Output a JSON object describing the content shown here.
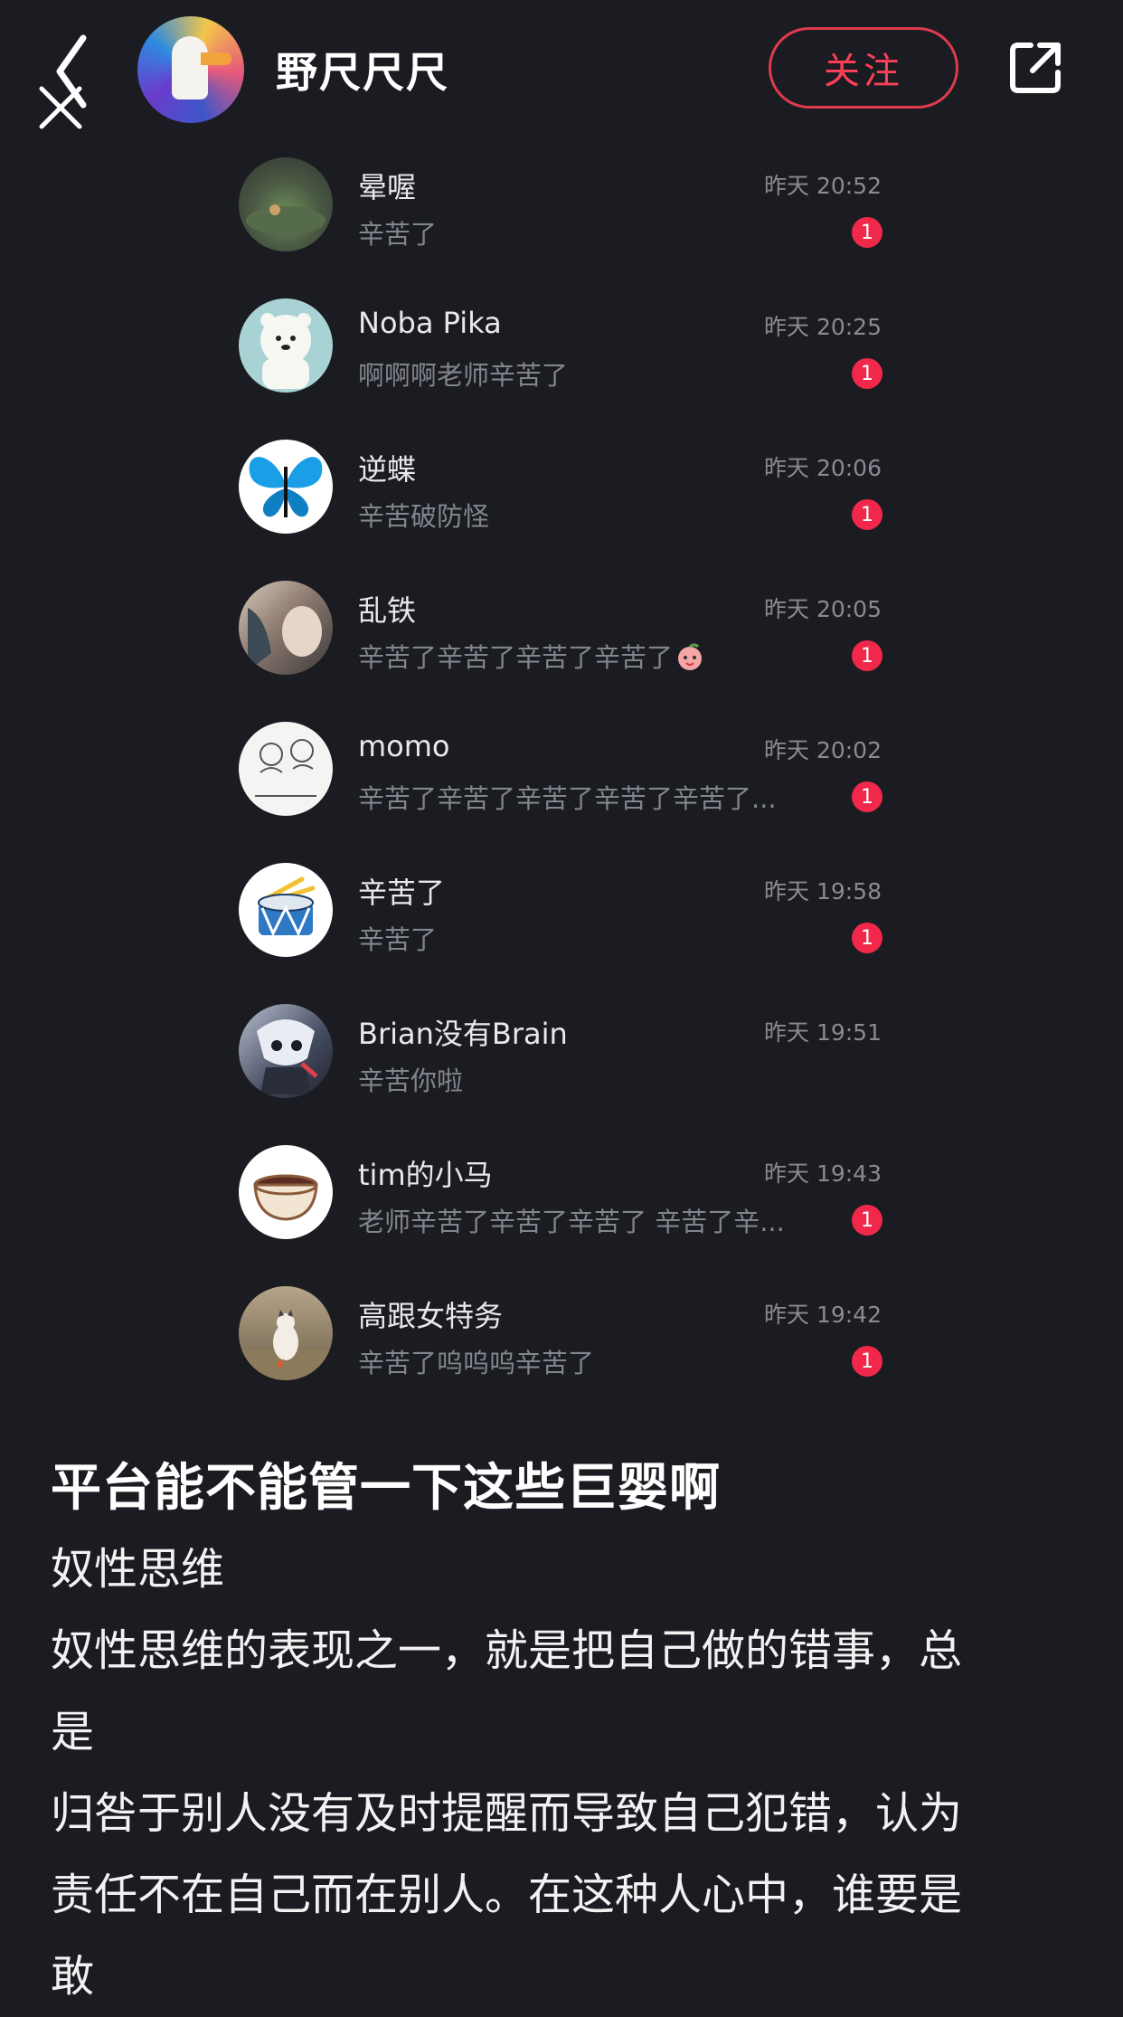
{
  "header": {
    "user_name": "野尺尺尺",
    "follow_label": "关注",
    "back_icon": "chevron-left-icon",
    "close_icon": "close-icon",
    "share_icon": "share-icon"
  },
  "conversations": [
    {
      "name": "晕喔",
      "time": "昨天 20:52",
      "preview": "辛苦了",
      "unread": "1"
    },
    {
      "name": "Noba Pika",
      "time": "昨天 20:25",
      "preview": "啊啊啊老师辛苦了",
      "unread": "1"
    },
    {
      "name": "逆蝶",
      "time": "昨天 20:06",
      "preview": "辛苦破防怪",
      "unread": "1"
    },
    {
      "name": "乱铁",
      "time": "昨天 20:05",
      "preview": "辛苦了辛苦了辛苦了辛苦了",
      "unread": "1"
    },
    {
      "name": "momo",
      "time": "昨天 20:02",
      "preview": "辛苦了辛苦了辛苦了辛苦了辛苦了...",
      "unread": "1"
    },
    {
      "name": "辛苦了",
      "time": "昨天 19:58",
      "preview": "辛苦了",
      "unread": "1"
    },
    {
      "name": "Brian没有Brain",
      "time": "昨天 19:51",
      "preview": "辛苦你啦",
      "unread": ""
    },
    {
      "name": "tim的小马",
      "time": "昨天 19:43",
      "preview": "老师辛苦了辛苦了辛苦了 辛苦了辛...",
      "unread": "1"
    },
    {
      "name": "高跟女特务",
      "time": "昨天 19:42",
      "preview": "辛苦了呜呜呜辛苦了",
      "unread": "1"
    }
  ],
  "post": {
    "title": "平台能不能管一下这些巨婴啊",
    "lines": [
      "奴性思维",
      "奴性思维的表现之一，就是把自己做的错事，总",
      "是",
      "归咎于别人没有及时提醒而导致自己犯错，认为",
      "责任不在自己而在别人。在这种人心中，谁要是",
      "敢"
    ]
  },
  "colors": {
    "background": "#1b1c21",
    "accent": "#ff3f58",
    "badge": "#f2284a"
  }
}
